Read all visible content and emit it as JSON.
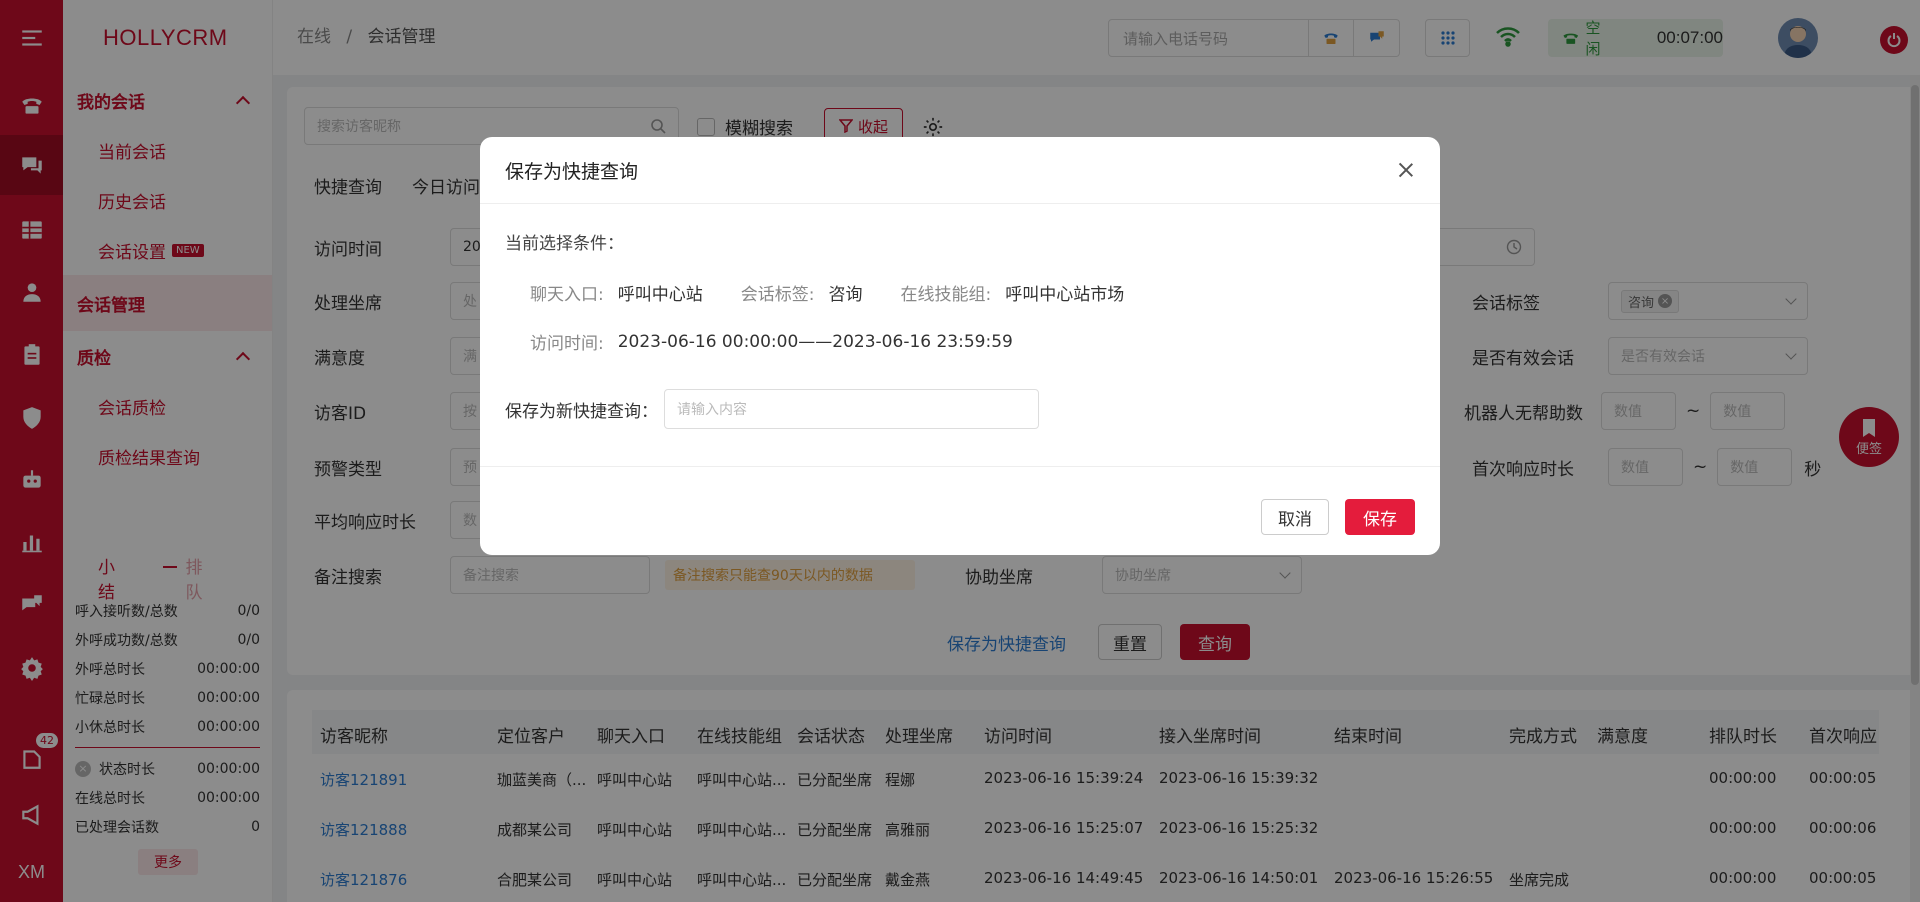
{
  "rail": {
    "items": [
      "menu-icon",
      "phone-icon",
      "chat-icon",
      "grid-icon",
      "user-icon",
      "clipboard-icon",
      "shield-icon",
      "robot-icon",
      "bar-chart-icon",
      "message-icon",
      "gear-icon",
      "file-icon",
      "megaphone-icon"
    ],
    "badge": "42",
    "footer": "XM"
  },
  "sidebar": {
    "logo": "HOLLYCRM",
    "group1": "我的会话",
    "item_current": "当前会话",
    "item_history": "历史会话",
    "item_settings": "会话设置",
    "new_badge": "NEW",
    "active_item": "会话管理",
    "group2": "质检",
    "item_qc": "会话质检",
    "item_qc_result": "质检结果查询"
  },
  "summary": {
    "tab1": "小结",
    "tab2": "排队",
    "rows": [
      {
        "label": "呼入接听数/总数",
        "value": "0/0"
      },
      {
        "label": "外呼成功数/总数",
        "value": "0/0"
      },
      {
        "label": "外呼总时长",
        "value": "00:00:00"
      },
      {
        "label": "忙碌总时长",
        "value": "00:00:00"
      },
      {
        "label": "小休总时长",
        "value": "00:00:00"
      }
    ],
    "rows2": [
      {
        "label": "状态时长",
        "value": "00:00:00"
      },
      {
        "label": "在线总时长",
        "value": "00:00:00"
      },
      {
        "label": "已处理会话数",
        "value": "0"
      }
    ],
    "more": "更多"
  },
  "header": {
    "crumb_parent": "在线",
    "crumb_sep": "/",
    "crumb_current": "会话管理",
    "phone_placeholder": "请输入电话号码",
    "status": "空闲",
    "timer": "00:07:00"
  },
  "filters": {
    "search_placeholder": "搜索访客昵称",
    "fuzzy": "模糊搜索",
    "collapse": "收起",
    "quick_query": "快捷查询",
    "today_visit": "今日访问",
    "visit_time": "访问时间",
    "visit_time_value": "20",
    "agent": "处理坐席",
    "agent_ph": "处",
    "satisfaction": "满意度",
    "satisfaction_ph": "满",
    "visitor_id": "访客ID",
    "visitor_id_ph": "按",
    "alert_type": "预警类型",
    "alert_type_ph": "预",
    "avg_resp": "平均响应时长",
    "avg_resp_ph": "数",
    "note_search": "备注搜索",
    "note_placeholder": "备注搜索",
    "note_warning": "备注搜索只能查90天以内的数据",
    "assist_agent": "协助坐席",
    "assist_placeholder": "协助坐席",
    "session_tag": "会话标签",
    "session_tag_value": "咨询",
    "valid_session": "是否有效会话",
    "valid_session_ph": "是否有效会话",
    "robot_no_help": "机器人无帮助数",
    "num_ph": "数值",
    "tilde": "~",
    "first_resp": "首次响应时长",
    "sec": "秒",
    "save_quick": "保存为快捷查询",
    "reset": "重置",
    "query": "查询"
  },
  "table": {
    "headers": [
      "访客昵称",
      "定位客户",
      "聊天入口",
      "在线技能组",
      "会话状态",
      "处理坐席",
      "访问时间",
      "接入坐席时间",
      "结束时间",
      "完成方式",
      "满意度",
      "排队时长",
      "首次响应"
    ],
    "rows": [
      [
        "访客121891",
        "珈蓝美商（...",
        "呼叫中心站",
        "呼叫中心站...",
        "已分配坐席",
        "程娜",
        "2023-06-16 15:39:24",
        "2023-06-16 15:39:32",
        "",
        "",
        "",
        "00:00:00",
        "00:00:05"
      ],
      [
        "访客121888",
        "成都某公司",
        "呼叫中心站",
        "呼叫中心站...",
        "已分配坐席",
        "高雅丽",
        "2023-06-16 15:25:07",
        "2023-06-16 15:25:32",
        "",
        "",
        "",
        "00:00:00",
        "00:00:06"
      ],
      [
        "访客121876",
        "合肥某公司",
        "呼叫中心站",
        "呼叫中心站...",
        "已分配坐席",
        "戴金燕",
        "2023-06-16 14:49:45",
        "2023-06-16 14:50:01",
        "2023-06-16 15:26:55",
        "坐席完成",
        "",
        "00:00:00",
        "00:00:05"
      ]
    ]
  },
  "modal": {
    "title": "保存为快捷查询",
    "cond_label": "当前选择条件：",
    "k_entry": "聊天入口:",
    "v_entry": "呼叫中心站",
    "k_tag": "会话标签:",
    "v_tag": "咨询",
    "k_group": "在线技能组:",
    "v_group": "呼叫中心站市场",
    "k_time": "访问时间:",
    "v_time": "2023-06-16 00:00:00——2023-06-16 23:59:59",
    "save_label": "保存为新快捷查询：",
    "input_placeholder": "请输入内容",
    "cancel": "取消",
    "save": "保存"
  },
  "float_note": "便签",
  "colors": {
    "brand": "#c8102e",
    "link": "#2d7dd2",
    "status_green": "#2e9a3e"
  }
}
